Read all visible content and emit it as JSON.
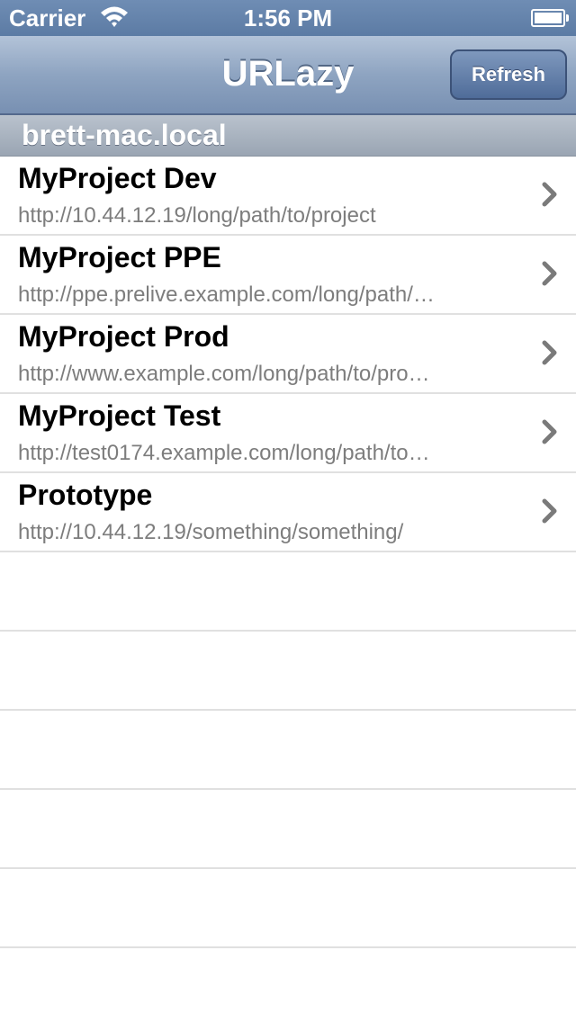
{
  "status_bar": {
    "carrier": "Carrier",
    "time": "1:56 PM"
  },
  "nav_bar": {
    "title": "URLazy",
    "refresh_label": "Refresh"
  },
  "section": {
    "title": "brett-mac.local"
  },
  "rows": [
    {
      "title": "MyProject Dev",
      "url": "http://10.44.12.19/long/path/to/project"
    },
    {
      "title": "MyProject PPE",
      "url": "http://ppe.prelive.example.com/long/path/…"
    },
    {
      "title": "MyProject Prod",
      "url": "http://www.example.com/long/path/to/pro…"
    },
    {
      "title": "MyProject Test",
      "url": "http://test0174.example.com/long/path/to…"
    },
    {
      "title": "Prototype",
      "url": "http://10.44.12.19/something/something/"
    }
  ],
  "icons": {
    "wifi": "wifi-icon",
    "battery": "battery-icon",
    "chevron": "chevron-right-icon"
  }
}
